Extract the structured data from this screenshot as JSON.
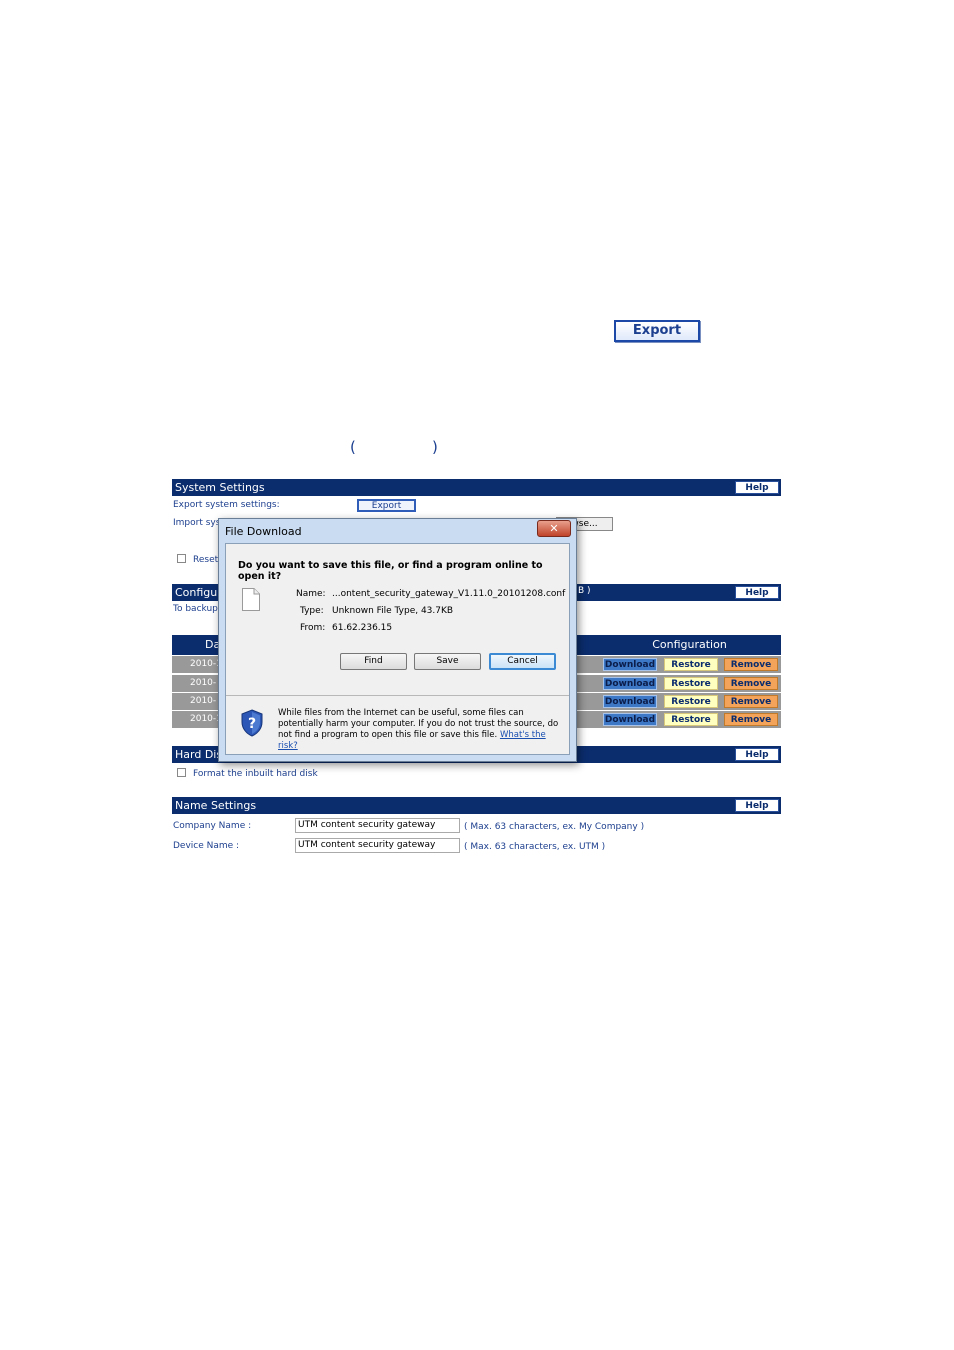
{
  "doc": {
    "export_button": "Export",
    "paren_open": "(",
    "paren_close": ")"
  },
  "system_settings": {
    "title": "System Settings",
    "help": "Help",
    "export_label": "Export system settings:",
    "export_button": "Export",
    "import_label": "Import sys",
    "browse_button": "wse...",
    "reset_label": "Reset"
  },
  "configuration": {
    "title": "Configur",
    "help": "Help",
    "note": "To backup",
    "note_suffix": "B )",
    "col_date": "Da",
    "col_config": "Configuration",
    "rows": [
      {
        "date": "2010-1",
        "download": "Download",
        "restore": "Restore",
        "remove": "Remove"
      },
      {
        "date": "2010-",
        "download": "Download",
        "restore": "Restore",
        "remove": "Remove"
      },
      {
        "date": "2010-",
        "download": "Download",
        "restore": "Restore",
        "remove": "Remove"
      },
      {
        "date": "2010-1",
        "download": "Download",
        "restore": "Restore",
        "remove": "Remove"
      }
    ]
  },
  "hard_disk": {
    "title": "Hard Dis",
    "help": "Help",
    "format_label": "Format the inbuilt hard disk"
  },
  "name_settings": {
    "title": "Name Settings",
    "help": "Help",
    "company_label": "Company Name :",
    "company_value": "UTM content security gateway",
    "company_hint": "( Max. 63 characters, ex. My Company )",
    "device_label": "Device Name :",
    "device_value": "UTM content security gateway",
    "device_hint": "( Max. 63 characters, ex. UTM )"
  },
  "dialog": {
    "title": "File Download",
    "close": "✕",
    "question": "Do you want to save this file, or find a program online to open it?",
    "name_label": "Name:",
    "name_value": "...ontent_security_gateway_V1.11.0_20101208.conf",
    "type_label": "Type:",
    "type_value": "Unknown File Type, 43.7KB",
    "from_label": "From:",
    "from_value": "61.62.236.15",
    "find_button": "Find",
    "save_button": "Save",
    "cancel_button": "Cancel",
    "warning": "While files from the Internet can be useful, some files can potentially harm your computer. If you do not trust the source, do not find a program to open this file or save this file.",
    "risk_link": "What's the risk?"
  }
}
